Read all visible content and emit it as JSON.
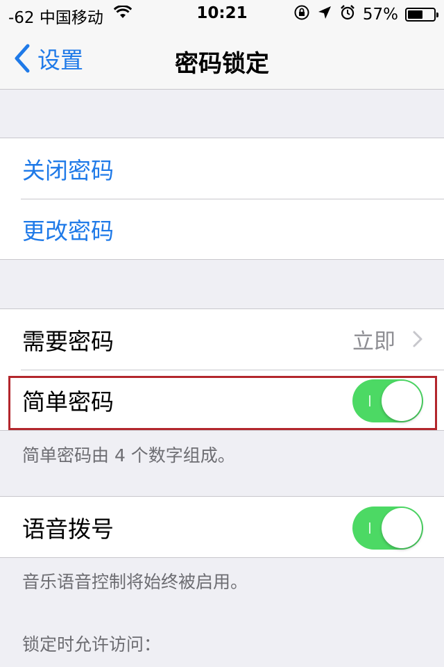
{
  "status_bar": {
    "carrier": "-62 中国移动",
    "time": "10:21",
    "battery": "57%",
    "battery_level": 0.57,
    "icons": [
      "wifi-icon",
      "rotation-lock-icon",
      "location-arrow-icon",
      "alarm-icon",
      "battery-icon"
    ]
  },
  "nav": {
    "back_label": "设置",
    "title": "密码锁定"
  },
  "groups": {
    "passcode": {
      "turn_off": "关闭密码",
      "change": "更改密码"
    },
    "settings": {
      "require_passcode": "需要密码",
      "require_value": "立即",
      "simple_passcode": "简单密码",
      "simple_passcode_on": true
    },
    "simple_footer": "简单密码由 4 个数字组成。",
    "voice": {
      "voice_dial": "语音拨号",
      "voice_dial_on": true
    },
    "voice_footer": "音乐语音控制将始终被启用。",
    "allow_access_header": "锁定时允许访问："
  },
  "colors": {
    "accent": "#1f7ae8",
    "toggle_on": "#4cd964",
    "highlight": "#b3262c",
    "background": "#efeff4"
  }
}
